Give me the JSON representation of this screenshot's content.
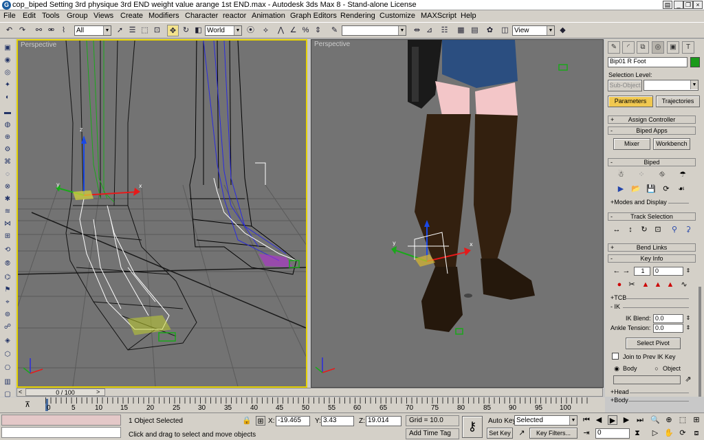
{
  "window": {
    "title": "cop_biped Setting 3rd physique 3rd END weight value arange 1st END.max - Autodesk 3ds Max 8 - Stand-alone License",
    "app_icon": "G"
  },
  "menu": [
    "File",
    "Edit",
    "Tools",
    "Group",
    "Views",
    "Create",
    "Modifiers",
    "Character",
    "reactor",
    "Animation",
    "Graph Editors",
    "Rendering",
    "Customize",
    "MAXScript",
    "Help"
  ],
  "toolbar": {
    "selection_filter": "All",
    "reference_coord": "World",
    "named_selection": "",
    "render_view": "View"
  },
  "viewports": {
    "left_label": "Perspective",
    "right_label": "Perspective"
  },
  "panel": {
    "object_name": "Bip01 R Foot",
    "object_color": "#1a9a1a",
    "selection_level_label": "Selection Level:",
    "sub_object_button": "Sub-Object",
    "parameters_tab": "Parameters",
    "trajectories_tab": "Trajectories",
    "assign_controller": "Assign Controller",
    "biped_apps": "Biped Apps",
    "mixer": "Mixer",
    "workbench": "Workbench",
    "biped": "Biped",
    "modes_display": "+Modes and Display",
    "track_selection": "Track Selection",
    "bend_links": "Bend Links",
    "key_info": "Key Info",
    "key_index": "1",
    "key_time": "0",
    "tcb": "+TCB",
    "ik": "- IK",
    "ik_blend_label": "IK Blend:",
    "ik_blend_value": "0.0",
    "ankle_tension_label": "Ankle Tension:",
    "ankle_tension_value": "0.0",
    "select_pivot": "Select Pivot",
    "join_prev_ik": "Join to Prev IK Key",
    "body_radio": "Body",
    "object_radio": "Object",
    "head": "+Head",
    "body": "+Body"
  },
  "timeline": {
    "slider_label": "0 / 100",
    "ticks": [
      "0",
      "5",
      "10",
      "15",
      "20",
      "25",
      "30",
      "35",
      "40",
      "45",
      "50",
      "55",
      "60",
      "65",
      "70",
      "75",
      "80",
      "85",
      "90",
      "95",
      "100"
    ]
  },
  "status": {
    "selection_info": "1 Object Selected",
    "prompt": "Click and drag to select and move objects",
    "x_label": "X:",
    "x_value": "-19.465",
    "y_label": "Y:",
    "y_value": "3.43",
    "z_label": "Z:",
    "z_value": "19.014",
    "grid": "Grid = 10.0",
    "add_time_tag": "Add Time Tag",
    "auto_key": "Auto Key",
    "set_key": "Set Key",
    "key_mode": "Selected",
    "key_filters": "Key Filters...",
    "current_frame": "0"
  }
}
